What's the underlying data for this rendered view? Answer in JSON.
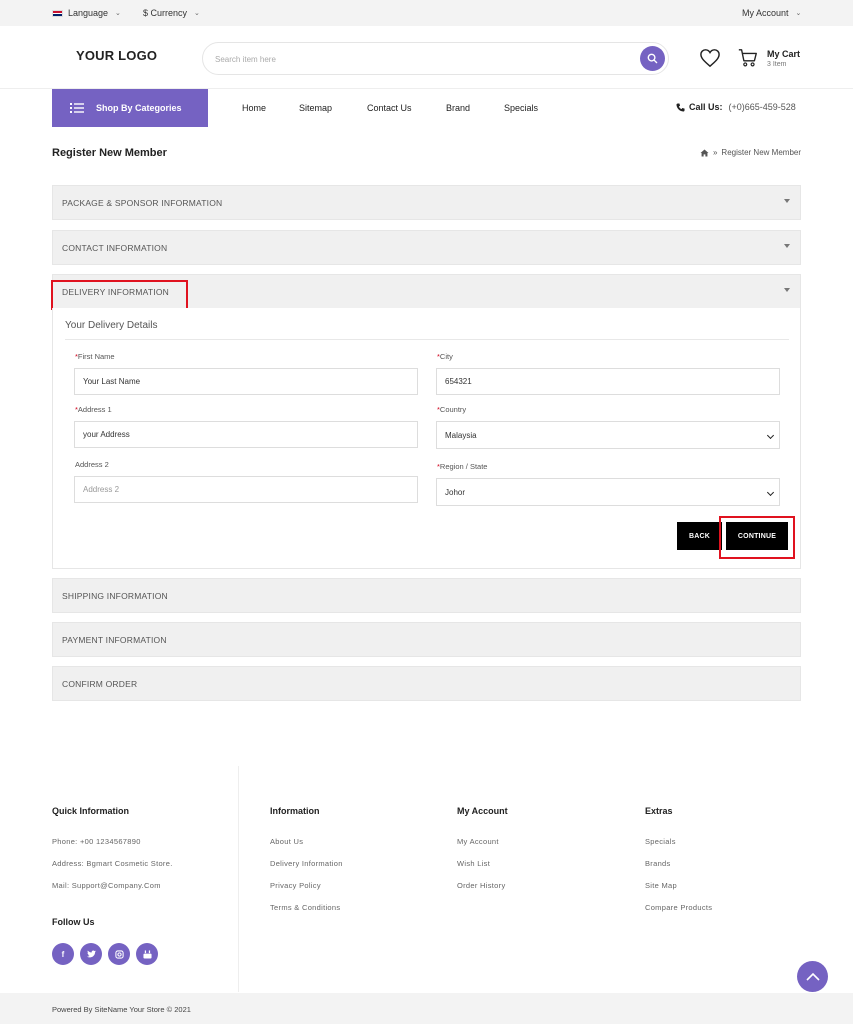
{
  "topbar": {
    "language": "Language",
    "currency": "$ Currency",
    "account": "My Account"
  },
  "header": {
    "logo": "YOUR LOGO",
    "search_placeholder": "Search item here",
    "cart_title": "My Cart",
    "cart_count": "3 Item"
  },
  "nav": {
    "categories": "Shop By Categories",
    "links": [
      "Home",
      "Sitemap",
      "Contact Us",
      "Brand",
      "Specials"
    ],
    "call_label": "Call Us:",
    "call_number": "(+0)665-459-528"
  },
  "page": {
    "title": "Register New Member",
    "breadcrumb": "Register New Member"
  },
  "accordion": {
    "package": "PACKAGE & SPONSOR INFORMATION",
    "contact": "CONTACT INFORMATION",
    "delivery": "DELIVERY INFORMATION",
    "shipping": "SHIPPING INFORMATION",
    "payment": "PAYMENT INFORMATION",
    "confirm": "CONFIRM ORDER"
  },
  "delivery_form": {
    "heading": "Your Delivery Details",
    "required_mark": "*",
    "first_name_label": "First Name",
    "first_name_value": "Your Last Name",
    "address1_label": "Address 1",
    "address1_value": "your Address",
    "address2_label": "Address 2",
    "address2_placeholder": "Address 2",
    "city_label": "City",
    "city_value": "654321",
    "country_label": "Country",
    "country_value": "Malaysia",
    "region_label": "Region / State",
    "region_value": "Johor",
    "back_label": "BACK",
    "continue_label": "CONTINUE"
  },
  "footer": {
    "quick_info": {
      "title": "Quick Information",
      "phone": "Phone: +00 1234567890",
      "address": "Address: Bgmart Cosmetic Store.",
      "mail": "Mail: Support@Company.Com"
    },
    "follow_title": "Follow Us",
    "social": [
      "f",
      "t",
      "ig",
      "yt"
    ],
    "information": {
      "title": "Information",
      "items": [
        "About Us",
        "Delivery Information",
        "Privacy Policy",
        "Terms & Conditions"
      ]
    },
    "my_account": {
      "title": "My Account",
      "items": [
        "My Account",
        "Wish List",
        "Order History"
      ]
    },
    "extras": {
      "title": "Extras",
      "items": [
        "Specials",
        "Brands",
        "Site Map",
        "Compare Products"
      ]
    },
    "copyright": "Powered By SiteName Your Store © 2021"
  },
  "colors": {
    "accent": "#7562c2",
    "highlight": "#e0121f",
    "button": "#000000"
  }
}
